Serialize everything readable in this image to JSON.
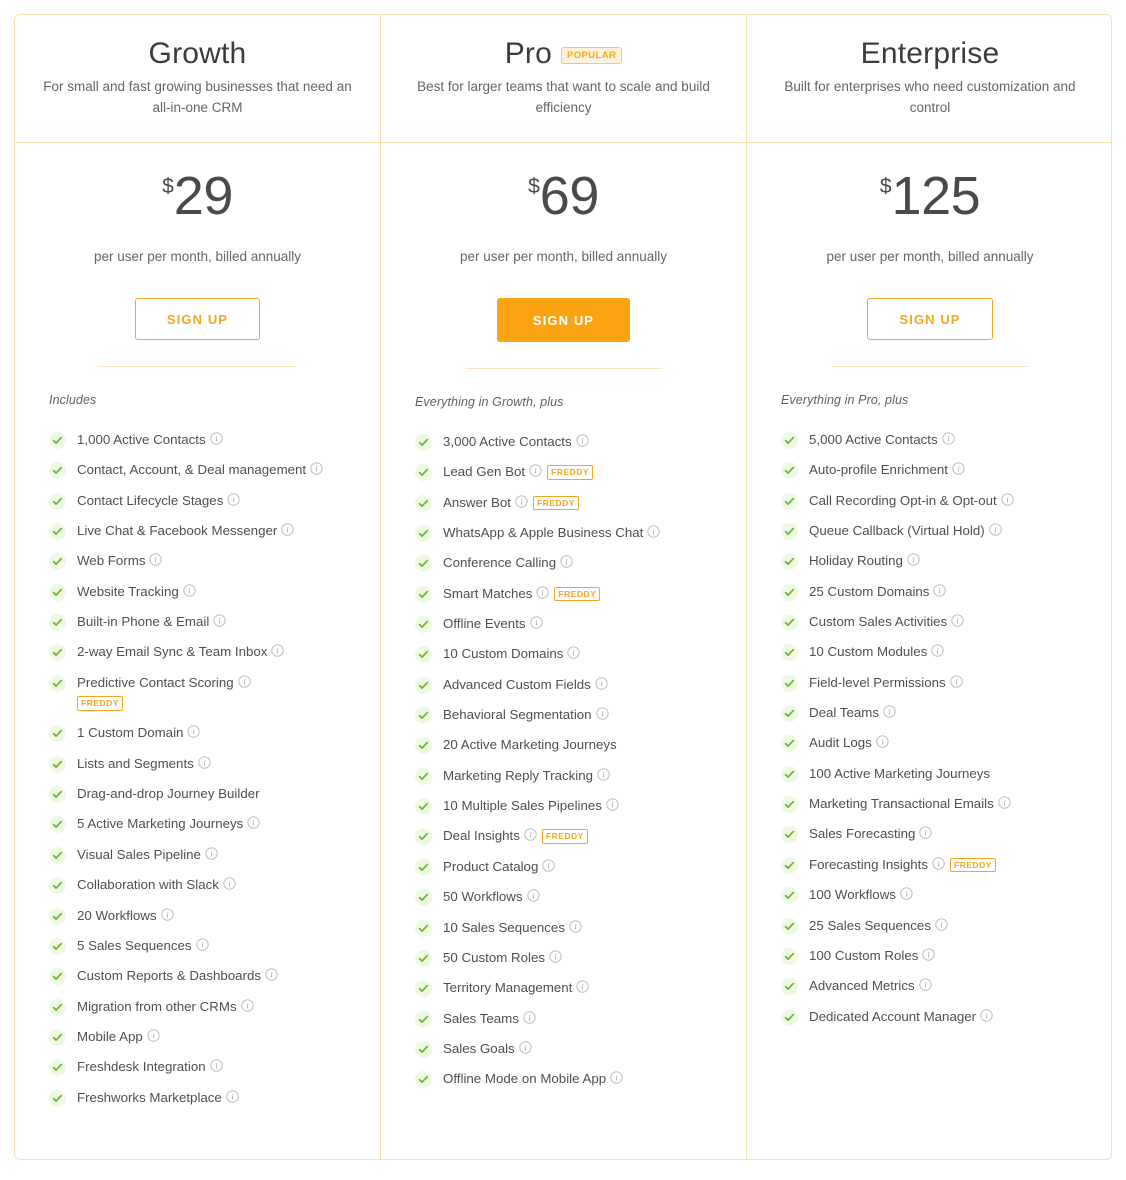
{
  "currency_symbol": "$",
  "price_note": "per user per month, billed annually",
  "signup_label": "SIGN UP",
  "colors": {
    "accent": "#f5a623",
    "accent_filled": "#fca311",
    "border": "#fae0b0",
    "check_green": "#6ab42f",
    "check_bg": "#eef8e2",
    "text_dark": "#3c3c3c",
    "text_body": "#4c5054",
    "badge_bg": "#fdf3de"
  },
  "plans": [
    {
      "name": "Growth",
      "badge": null,
      "description": "For small and fast growing businesses that need an all-in-one CRM",
      "price": "29",
      "button_style": "outline",
      "includes_label": "Includes",
      "features": [
        {
          "label": "1,000 Active Contacts",
          "info": true,
          "freddy": false
        },
        {
          "label": "Contact, Account, & Deal management",
          "info": true,
          "freddy": false
        },
        {
          "label": "Contact Lifecycle Stages",
          "info": true,
          "freddy": false
        },
        {
          "label": "Live Chat & Facebook Messenger",
          "info": true,
          "freddy": false
        },
        {
          "label": "Web Forms",
          "info": true,
          "freddy": false
        },
        {
          "label": "Website Tracking",
          "info": true,
          "freddy": false
        },
        {
          "label": "Built-in Phone & Email",
          "info": true,
          "freddy": false
        },
        {
          "label": "2-way Email Sync & Team Inbox",
          "info": true,
          "freddy": false
        },
        {
          "label": "Predictive Contact Scoring",
          "info": true,
          "freddy": true,
          "freddy_text": "FREDDY",
          "freddy_wrap": true
        },
        {
          "label": "1 Custom Domain",
          "info": true,
          "freddy": false
        },
        {
          "label": "Lists and Segments",
          "info": true,
          "freddy": false
        },
        {
          "label": "Drag-and-drop Journey Builder",
          "info": false,
          "freddy": false
        },
        {
          "label": "5 Active Marketing Journeys",
          "info": true,
          "freddy": false
        },
        {
          "label": "Visual Sales Pipeline",
          "info": true,
          "freddy": false
        },
        {
          "label": "Collaboration with Slack",
          "info": true,
          "freddy": false
        },
        {
          "label": "20 Workflows",
          "info": true,
          "freddy": false
        },
        {
          "label": "5 Sales Sequences",
          "info": true,
          "freddy": false
        },
        {
          "label": "Custom Reports & Dashboards",
          "info": true,
          "freddy": false
        },
        {
          "label": "Migration from other CRMs",
          "info": true,
          "freddy": false
        },
        {
          "label": "Mobile App",
          "info": true,
          "freddy": false
        },
        {
          "label": "Freshdesk Integration",
          "info": true,
          "freddy": false
        },
        {
          "label": "Freshworks Marketplace",
          "info": true,
          "freddy": false
        }
      ]
    },
    {
      "name": "Pro",
      "badge": "POPULAR",
      "description": "Best for larger teams that want to scale and build efficiency",
      "price": "69",
      "button_style": "filled",
      "includes_label": "Everything in Growth, plus",
      "features": [
        {
          "label": "3,000 Active Contacts",
          "info": true,
          "freddy": false
        },
        {
          "label": "Lead Gen Bot",
          "info": true,
          "freddy": true,
          "freddy_text": "FREDDY"
        },
        {
          "label": "Answer Bot",
          "info": true,
          "freddy": true,
          "freddy_text": "FREDDY"
        },
        {
          "label": "WhatsApp & Apple Business Chat",
          "info": true,
          "freddy": false
        },
        {
          "label": "Conference Calling",
          "info": true,
          "freddy": false
        },
        {
          "label": "Smart Matches",
          "info": true,
          "freddy": true,
          "freddy_text": "FREDDY"
        },
        {
          "label": "Offline Events",
          "info": true,
          "freddy": false
        },
        {
          "label": "10 Custom Domains",
          "info": true,
          "freddy": false
        },
        {
          "label": "Advanced Custom Fields",
          "info": true,
          "freddy": false
        },
        {
          "label": "Behavioral Segmentation",
          "info": true,
          "freddy": false
        },
        {
          "label": "20 Active Marketing Journeys",
          "info": false,
          "freddy": false
        },
        {
          "label": "Marketing Reply Tracking",
          "info": true,
          "freddy": false
        },
        {
          "label": "10 Multiple Sales Pipelines",
          "info": true,
          "freddy": false
        },
        {
          "label": "Deal Insights",
          "info": true,
          "freddy": true,
          "freddy_text": "FREDDY"
        },
        {
          "label": "Product Catalog",
          "info": true,
          "freddy": false
        },
        {
          "label": "50 Workflows",
          "info": true,
          "freddy": false
        },
        {
          "label": "10 Sales Sequences",
          "info": true,
          "freddy": false
        },
        {
          "label": "50 Custom Roles",
          "info": true,
          "freddy": false
        },
        {
          "label": "Territory Management",
          "info": true,
          "freddy": false
        },
        {
          "label": "Sales Teams",
          "info": true,
          "freddy": false
        },
        {
          "label": "Sales Goals",
          "info": true,
          "freddy": false
        },
        {
          "label": "Offline Mode on Mobile App",
          "info": true,
          "freddy": false
        }
      ]
    },
    {
      "name": "Enterprise",
      "badge": null,
      "description": "Built for enterprises who need customization and control",
      "price": "125",
      "button_style": "outline",
      "includes_label": "Everything in Pro, plus",
      "features": [
        {
          "label": "5,000 Active Contacts",
          "info": true,
          "freddy": false
        },
        {
          "label": "Auto-profile Enrichment",
          "info": true,
          "freddy": false
        },
        {
          "label": "Call Recording Opt-in & Opt-out",
          "info": true,
          "freddy": false
        },
        {
          "label": "Queue Callback (Virtual Hold)",
          "info": true,
          "freddy": false
        },
        {
          "label": "Holiday Routing",
          "info": true,
          "freddy": false
        },
        {
          "label": "25 Custom Domains",
          "info": true,
          "freddy": false
        },
        {
          "label": "Custom Sales Activities",
          "info": true,
          "freddy": false
        },
        {
          "label": "10 Custom Modules",
          "info": true,
          "freddy": false
        },
        {
          "label": "Field-level Permissions",
          "info": true,
          "freddy": false
        },
        {
          "label": "Deal Teams",
          "info": true,
          "freddy": false
        },
        {
          "label": "Audit Logs",
          "info": true,
          "freddy": false
        },
        {
          "label": "100 Active Marketing Journeys",
          "info": false,
          "freddy": false
        },
        {
          "label": "Marketing Transactional Emails",
          "info": true,
          "freddy": false
        },
        {
          "label": "Sales Forecasting",
          "info": true,
          "freddy": false
        },
        {
          "label": "Forecasting Insights",
          "info": true,
          "freddy": true,
          "freddy_text": "FREDDY"
        },
        {
          "label": "100 Workflows",
          "info": true,
          "freddy": false
        },
        {
          "label": "25 Sales Sequences",
          "info": true,
          "freddy": false
        },
        {
          "label": "100 Custom Roles",
          "info": true,
          "freddy": false
        },
        {
          "label": "Advanced Metrics",
          "info": true,
          "freddy": false
        },
        {
          "label": "Dedicated Account Manager",
          "info": true,
          "freddy": false
        }
      ]
    }
  ]
}
